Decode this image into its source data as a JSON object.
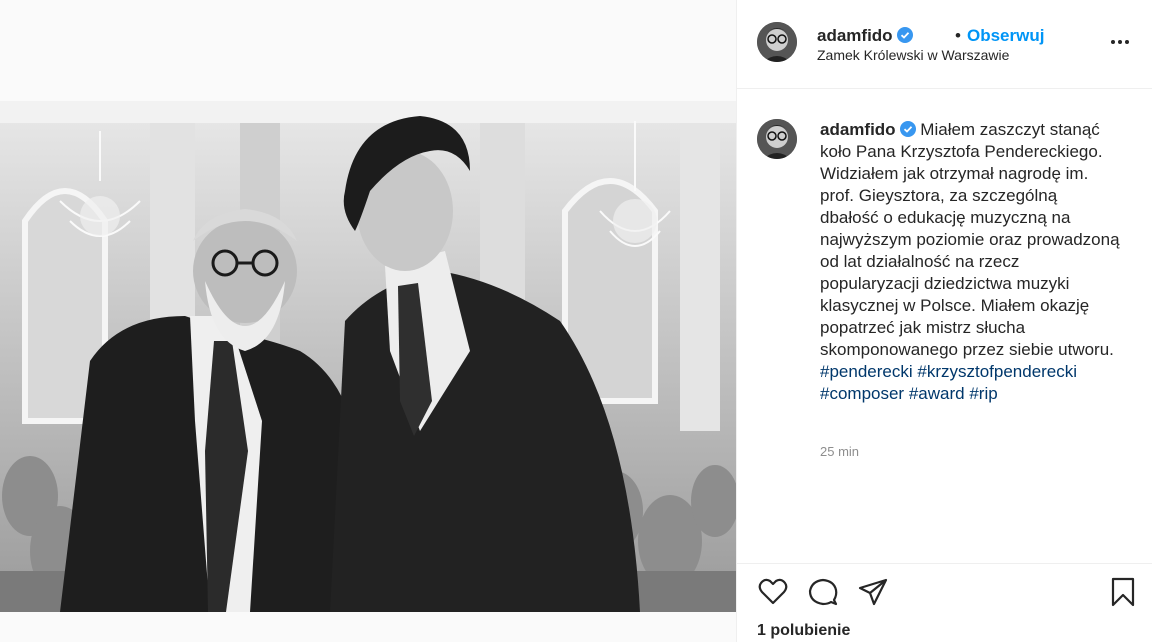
{
  "post": {
    "username": "adamfido",
    "dot": "•",
    "follow_label": "Obserwuj",
    "location": "Zamek Królewski w Warszawie",
    "caption_text": "Miałem zaszczyt stanąć koło Pana Krzysztofa Pendereckiego. Widziałem jak otrzymał nagrodę im. prof. Gieysztora, za szczególną dbałość o edukację muzyczną na najwyższym poziomie oraz prowadzoną od lat działalność na rzecz popularyzacji dziedzictwa muzyki klasycznej w Polsce. Miałem okazję popatrzeć jak mistrz słucha skomponowanego przez siebie utworu.",
    "hashtags": [
      "#penderecki",
      "#krzysztofpenderecki",
      "#composer",
      "#award",
      "#rip"
    ],
    "time": "25 min",
    "likes": "1 polubienie"
  },
  "colors": {
    "link_blue": "#0095f6",
    "hashtag": "#00376b",
    "verified_badge": "#3897f0",
    "muted": "#8e8e8e"
  },
  "icons": [
    "verified-badge-icon",
    "more-options-icon",
    "heart-icon",
    "comment-icon",
    "share-icon",
    "bookmark-icon"
  ]
}
